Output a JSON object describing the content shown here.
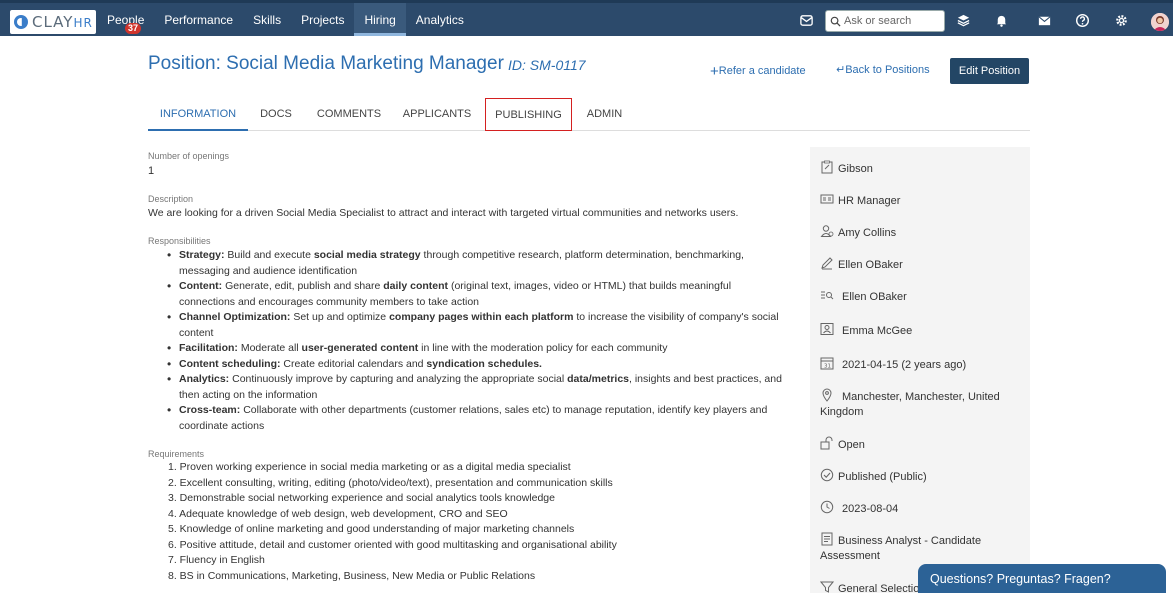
{
  "nav": {
    "logo_main": "CLAY",
    "logo_sub": "HR",
    "items": [
      {
        "label": "People",
        "badge": "37"
      },
      {
        "label": "Performance"
      },
      {
        "label": "Skills"
      },
      {
        "label": "Projects"
      },
      {
        "label": "Hiring"
      },
      {
        "label": "Analytics"
      }
    ],
    "search_placeholder": "Ask or search"
  },
  "header": {
    "title": "Position: Social Media Marketing Manager",
    "id": "ID: SM-0117",
    "refer": "Refer a candidate",
    "back": "Back to Positions",
    "edit": "Edit Position"
  },
  "tabs": [
    "INFORMATION",
    "DOCS",
    "COMMENTS",
    "APPLICANTS",
    "PUBLISHING",
    "ADMIN"
  ],
  "main": {
    "openings_label": "Number of openings",
    "openings_value": "1",
    "description_label": "Description",
    "description_value": "We are looking for a driven Social Media Specialist to attract and interact with targeted virtual communities and networks users.",
    "responsibilities_label": "Responsibilities",
    "responsibilities": [
      {
        "head": "Strategy:",
        "t1": " Build and execute ",
        "b1": "social media strategy",
        "t2": " through competitive research, platform determination, benchmarking, messaging and audience identification",
        "b2": "",
        "t3": ""
      },
      {
        "head": "Content:",
        "t1": " Generate, edit, publish and share ",
        "b1": "daily content",
        "t2": " (original text, images, video or HTML) that builds meaningful connections and encourages community members to take action",
        "b2": "",
        "t3": ""
      },
      {
        "head": "Channel Optimization:",
        "t1": " Set up and optimize ",
        "b1": "company pages within each platform",
        "t2": " to increase the visibility of company's social content",
        "b2": "",
        "t3": ""
      },
      {
        "head": "Facilitation:",
        "t1": " Moderate all ",
        "b1": "user-generated content",
        "t2": " in line with the moderation policy for each community",
        "b2": "",
        "t3": ""
      },
      {
        "head": "Content scheduling:",
        "t1": " Create editorial calendars and ",
        "b1": "syndication schedules.",
        "t2": "",
        "b2": "",
        "t3": ""
      },
      {
        "head": "Analytics:",
        "t1": " Continuously improve by capturing and analyzing the appropriate social ",
        "b1": "data/metrics",
        "t2": ", insights and best practices, and then acting on the information",
        "b2": "",
        "t3": ""
      },
      {
        "head": "Cross-team:",
        "t1": " Collaborate with other departments (customer relations, sales etc) to manage reputation, identify key players and coordinate actions",
        "b1": "",
        "t2": "",
        "b2": "",
        "t3": ""
      }
    ],
    "requirements_label": "Requirements",
    "requirements": [
      "1. Proven working experience in social media marketing or as a digital media specialist",
      "2. Excellent consulting, writing, editing (photo/video/text), presentation and communication skills",
      "3. Demonstrable social networking experience and social analytics tools knowledge",
      "4. Adequate knowledge of web design, web development, CRO and SEO",
      "5. Knowledge of online marketing and good understanding of major marketing channels",
      "6. Positive attitude, detail and customer oriented with good multitasking and organisational ability",
      "7. Fluency in English",
      "8. BS in Communications, Marketing, Business, New Media or Public Relations"
    ]
  },
  "side": {
    "rows": [
      {
        "icon": "clipboard-icon",
        "text": "Gibson"
      },
      {
        "icon": "id-card-icon",
        "text": "HR Manager"
      },
      {
        "icon": "user-icon",
        "text": "Amy Collins"
      },
      {
        "icon": "pencil-icon",
        "text": "Ellen OBaker"
      },
      {
        "icon": "list-search-icon",
        "text": "Ellen OBaker"
      },
      {
        "icon": "badge-icon",
        "text": "Emma McGee"
      },
      {
        "icon": "calendar-icon",
        "text": "2021-04-15 (2 years ago)"
      },
      {
        "icon": "location-pin-icon",
        "text": "Manchester, Manchester, United Kingdom"
      },
      {
        "icon": "unlock-icon",
        "text": "Open"
      },
      {
        "icon": "check-circle-icon",
        "text": "Published (Public)"
      },
      {
        "icon": "clock-icon",
        "text": "2023-08-04"
      },
      {
        "icon": "assessment-icon",
        "text": "Business Analyst - Candidate Assessment"
      },
      {
        "icon": "filter-icon",
        "text": "General Selection"
      }
    ]
  },
  "chat": {
    "label": "Questions? Preguntas? Fragen?"
  }
}
